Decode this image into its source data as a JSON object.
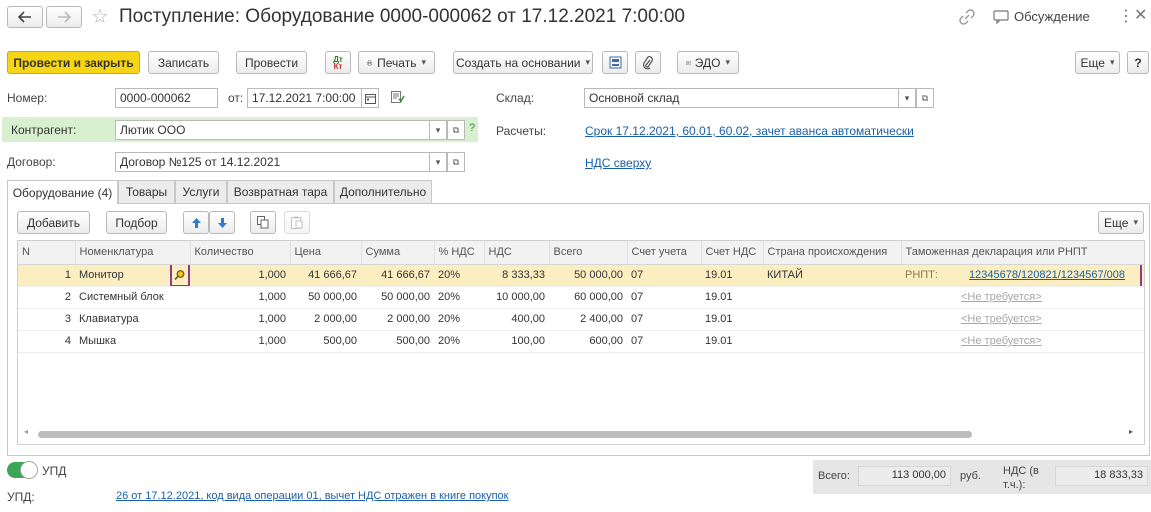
{
  "header": {
    "title": "Поступление: Оборудование 0000-000062 от 17.12.2021 7:00:00",
    "discuss_label": "Обсуждение"
  },
  "toolbar": {
    "post_close": "Провести и закрыть",
    "save": "Записать",
    "post": "Провести",
    "print": "Печать",
    "create_based": "Создать на основании",
    "edo": "ЭДО",
    "more": "Еще",
    "help": "?"
  },
  "form": {
    "number_label": "Номер:",
    "number_value": "0000-000062",
    "from_label": "от:",
    "date_value": "17.12.2021  7:00:00",
    "warehouse_label": "Склад:",
    "warehouse_value": "Основной склад",
    "counterparty_label": "Контрагент:",
    "counterparty_value": "Лютик ООО",
    "question": "?",
    "settlements_label": "Расчеты:",
    "settlements_link": "Срок 17.12.2021, 60.01, 60.02, зачет аванса автоматически",
    "contract_label": "Договор:",
    "contract_value": "Договор №125 от 14.12.2021",
    "vat_link": "НДС сверху"
  },
  "tabs": [
    {
      "label": "Оборудование (4)"
    },
    {
      "label": "Товары"
    },
    {
      "label": "Услуги"
    },
    {
      "label": "Возвратная тара"
    },
    {
      "label": "Дополнительно"
    }
  ],
  "table_toolbar": {
    "add": "Добавить",
    "pick": "Подбор",
    "more": "Еще"
  },
  "table": {
    "columns": [
      "N",
      "Номенклатура",
      "Количество",
      "Цена",
      "Сумма",
      "% НДС",
      "НДС",
      "Всего",
      "Счет учета",
      "Счет НДС",
      "Страна происхождения",
      "Таможенная декларация или РНПТ"
    ],
    "rows": [
      {
        "n": "1",
        "item": "Монитор",
        "qty": "1,000",
        "price": "41 666,67",
        "sum": "41 666,67",
        "vat_rate": "20%",
        "vat": "8 333,33",
        "total": "50 000,00",
        "account": "07",
        "vat_account": "19.01",
        "country": "КИТАЙ",
        "decl_prefix": "РНПТ:",
        "decl": "12345678/120821/1234567/008"
      },
      {
        "n": "2",
        "item": "Системный блок",
        "qty": "1,000",
        "price": "50 000,00",
        "sum": "50 000,00",
        "vat_rate": "20%",
        "vat": "10 000,00",
        "total": "60 000,00",
        "account": "07",
        "vat_account": "19.01",
        "country": "",
        "decl_prefix": "",
        "decl": "<Не требуется>"
      },
      {
        "n": "3",
        "item": "Клавиатура",
        "qty": "1,000",
        "price": "2 000,00",
        "sum": "2 000,00",
        "vat_rate": "20%",
        "vat": "400,00",
        "total": "2 400,00",
        "account": "07",
        "vat_account": "19.01",
        "country": "",
        "decl_prefix": "",
        "decl": "<Не требуется>"
      },
      {
        "n": "4",
        "item": "Мышка",
        "qty": "1,000",
        "price": "500,00",
        "sum": "500,00",
        "vat_rate": "20%",
        "vat": "100,00",
        "total": "600,00",
        "account": "07",
        "vat_account": "19.01",
        "country": "",
        "decl_prefix": "",
        "decl": "<Не требуется>"
      }
    ]
  },
  "footer": {
    "upd_toggle": "УПД",
    "upd_label": "УПД:",
    "upd_link": "26 от 17.12.2021, код вида операции 01, вычет НДС отражен в книге покупок",
    "total_label": "Всего:",
    "total_value": "113 000,00",
    "currency": "руб.",
    "vat_label_1": "НДС (в",
    "vat_label_2": "т.ч.):",
    "vat_value": "18 833,33"
  },
  "colors": {
    "primary_button": "#f5d516",
    "highlight_box": "#8e3a8e",
    "selected_row": "#fbeec0",
    "counterparty_bg": "#d8efd0",
    "link": "#1a5fa8",
    "toggle_on": "#3aa656"
  },
  "icons": [
    "back-icon",
    "forward-icon",
    "star-icon",
    "link-icon",
    "discussion-icon",
    "more-vert-icon",
    "close-icon",
    "dt-kt-icon",
    "printer-icon",
    "structure-icon",
    "paperclip-icon",
    "edo-icon",
    "calendar-icon",
    "post-status-icon",
    "arrow-up-icon",
    "arrow-down-icon",
    "copy-icon",
    "paste-icon",
    "search-icon"
  ]
}
